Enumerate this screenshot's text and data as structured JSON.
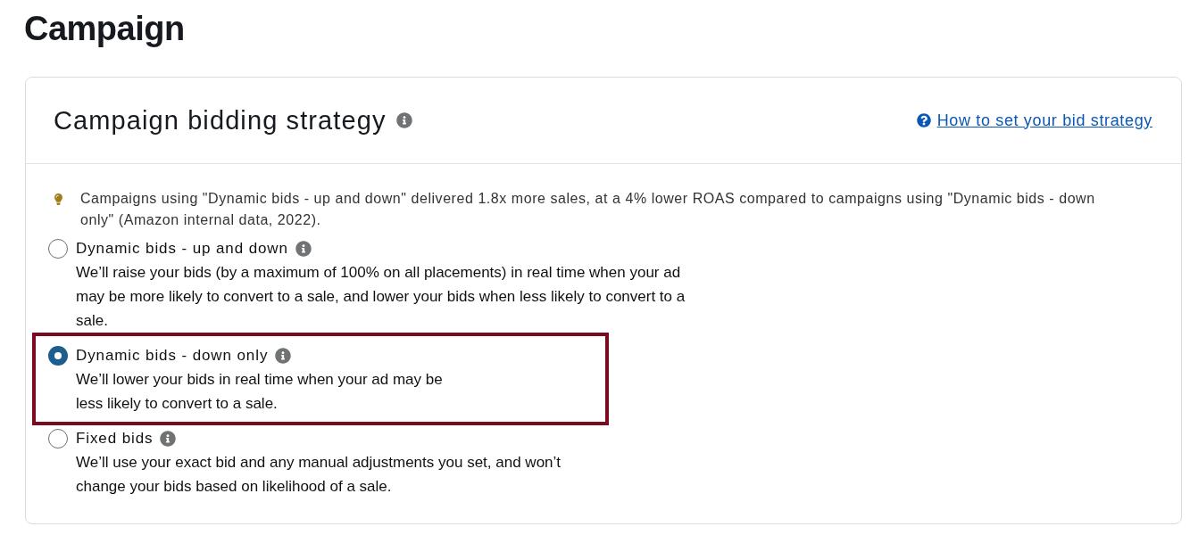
{
  "page": {
    "title": "Campaign"
  },
  "card": {
    "title": "Campaign bidding strategy",
    "help_link": "How to set your bid strategy",
    "tip": "Campaigns using \"Dynamic bids - up and down\" delivered 1.8x more sales, at a 4% lower ROAS compared to campaigns using \"Dynamic bids - down only\" (Amazon internal data, 2022).",
    "options": [
      {
        "label": "Dynamic bids - up and down",
        "description_lines": [
          "We’ll raise your bids (by a maximum of 100% on all placements) in real time when your ad",
          "may be more likely to convert to a sale, and lower your bids when less likely to convert to a",
          "sale."
        ],
        "selected": false,
        "highlighted": false
      },
      {
        "label": "Dynamic bids - down only",
        "description_lines": [
          "We’ll lower your bids in real time when your ad may be",
          "less likely to convert to a sale."
        ],
        "selected": true,
        "highlighted": true
      },
      {
        "label": "Fixed bids",
        "description_lines": [
          "We’ll use your exact bid and any manual adjustments you set, and won’t",
          "change your bids based on likelihood of a sale."
        ],
        "selected": false,
        "highlighted": false
      }
    ]
  }
}
